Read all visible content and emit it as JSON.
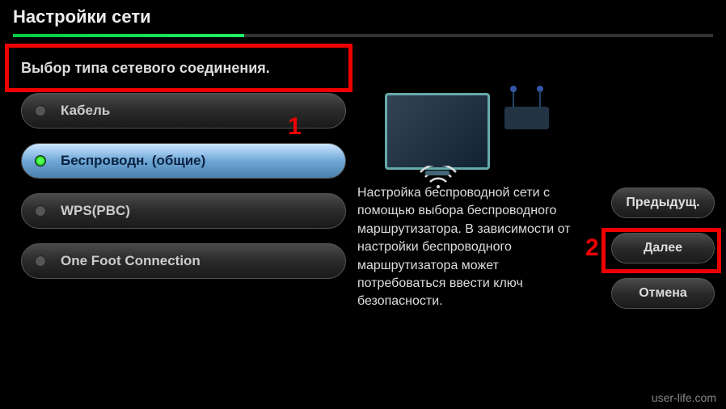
{
  "header": {
    "title": "Настройки сети"
  },
  "subtitle": "Выбор типа сетевого соединения.",
  "options": [
    {
      "label": "Кабель",
      "selected": false
    },
    {
      "label": "Беспроводн. (общие)",
      "selected": true
    },
    {
      "label": "WPS(PBC)",
      "selected": false
    },
    {
      "label": "One Foot Connection",
      "selected": false
    }
  ],
  "description": "Настройка беспроводной сети с помощью выбора беспроводного маршрутизатора. В зависимости от настройки беспроводного маршрутизатора может потребоваться ввести ключ безопасности.",
  "actions": {
    "prev": "Предыдущ.",
    "next": "Далее",
    "cancel": "Отмена"
  },
  "annotations": {
    "marker1": "1",
    "marker2": "2"
  },
  "watermark": "user-life.com",
  "icons": {
    "wifi": "wifi-icon",
    "monitor": "monitor-icon",
    "router": "router-icon"
  }
}
